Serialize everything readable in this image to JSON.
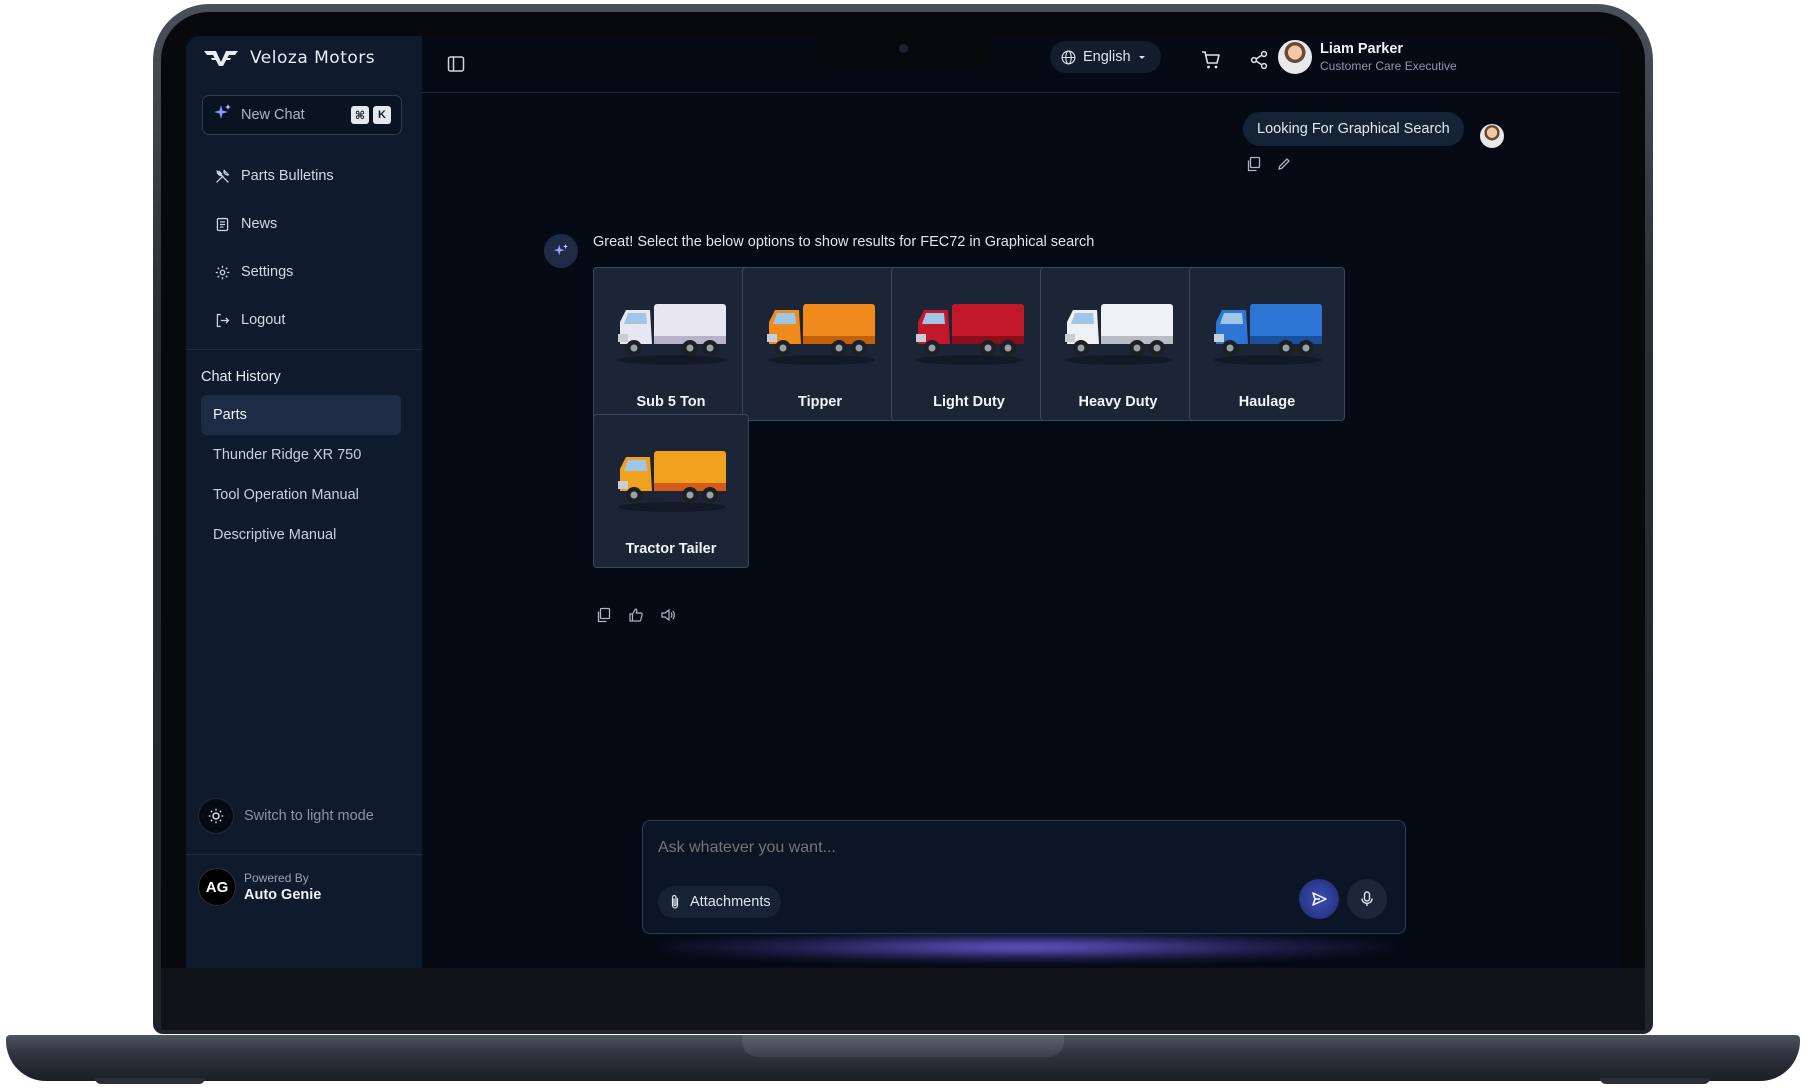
{
  "brand": {
    "name": "Veloza Motors"
  },
  "sidebar": {
    "new_chat_label": "New Chat",
    "shortcut_keys": [
      "⌘",
      "K"
    ],
    "nav_items": [
      {
        "label": "Parts Bulletins",
        "icon": "tools-icon"
      },
      {
        "label": "News",
        "icon": "news-icon"
      },
      {
        "label": "Settings",
        "icon": "gear-icon"
      },
      {
        "label": "Logout",
        "icon": "logout-icon"
      }
    ],
    "history_title": "Chat History",
    "history_items": [
      {
        "label": "Parts",
        "active": true
      },
      {
        "label": "Thunder Ridge XR 750",
        "active": false
      },
      {
        "label": "Tool Operation Manual",
        "active": false
      },
      {
        "label": "Descriptive Manual",
        "active": false
      }
    ],
    "theme_toggle_label": "Switch to light mode",
    "powered_by_label": "Powered By",
    "powered_by_name": "Auto Genie",
    "powered_by_logo_text": "AG"
  },
  "topbar": {
    "language": "English",
    "user_name": "Liam Parker",
    "user_role": "Customer Care Executive"
  },
  "chat": {
    "user_message": "Looking For Graphical Search",
    "bot_message": "Great! Select the below options to show results for FEC72 in Graphical search",
    "vehicle_options": [
      {
        "label": "Sub 5 Ton",
        "color": "#e8e6f0",
        "accent": "#b9b3c9"
      },
      {
        "label": "Tipper",
        "color": "#f08a1c",
        "accent": "#c45f0a"
      },
      {
        "label": "Light Duty",
        "color": "#c2182a",
        "accent": "#8a0f1b"
      },
      {
        "label": "Heavy Duty",
        "color": "#eef0f3",
        "accent": "#b8bcc4"
      },
      {
        "label": "Haulage",
        "color": "#2d76d6",
        "accent": "#1a4f9c"
      },
      {
        "label": "Tractor Tailer",
        "color": "#f0a11e",
        "accent": "#d35a18"
      }
    ]
  },
  "composer": {
    "placeholder": "Ask whatever you want...",
    "attachments_label": "Attachments"
  },
  "colors": {
    "screen_bg": "#050a15",
    "sidebar_bg": "#0f1a2c",
    "accent": "#8e96ff"
  }
}
